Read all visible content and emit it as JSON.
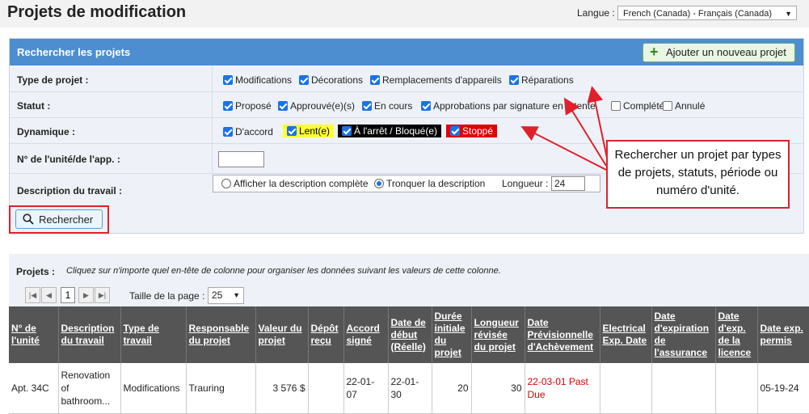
{
  "header": {
    "title": "Projets de modification",
    "language_label": "Langue :",
    "language_value": "French (Canada) - Français (Canada)"
  },
  "search": {
    "title": "Rechercher les projets",
    "add_button": "Ajouter un nouveau projet",
    "type_label": "Type de projet :",
    "type_options": [
      {
        "label": "Modifications",
        "checked": true
      },
      {
        "label": "Décorations",
        "checked": true
      },
      {
        "label": "Remplacements d'appareils",
        "checked": true
      },
      {
        "label": "Réparations",
        "checked": true
      }
    ],
    "status_label": "Statut :",
    "status_options": [
      {
        "label": "Proposé",
        "checked": true
      },
      {
        "label": "Approuvé(e)(s)",
        "checked": true
      },
      {
        "label": "En cours",
        "checked": true
      },
      {
        "label": "Approbations par signature en attente",
        "checked": true
      },
      {
        "label": "Complété",
        "checked": false
      },
      {
        "label": "Annulé",
        "checked": false
      }
    ],
    "dynamic_label": "Dynamique :",
    "dynamic_options": [
      {
        "label": "D'accord",
        "checked": true
      },
      {
        "label": "Lent(e)",
        "checked": true
      },
      {
        "label": "À l'arrêt / Bloqué(e)",
        "checked": true
      },
      {
        "label": "Stoppé",
        "checked": true
      }
    ],
    "unit_label": "N° de l'unité/de l'app. :",
    "unit_value": "",
    "work_label": "Description du travail :",
    "radio_full": "Afficher la description complète",
    "radio_truncate": "Tronquer la description",
    "length_label": "Longueur :",
    "length_value": "24",
    "search_button": "Rechercher"
  },
  "callout": {
    "text": "Rechercher un projet par types de projets, statuts, période ou numéro d'unité."
  },
  "projects": {
    "label": "Projets :",
    "hint": "Cliquez sur n'importe quel en-tête de colonne pour organiser les données suivant les valeurs de cette colonne.",
    "current_page": "1",
    "page_size_label": "Taille de la page :",
    "page_size": "25",
    "columns": [
      "N° de l'unité",
      "Description du travail",
      "Type de travail",
      "Responsable du projet",
      "Valeur du projet",
      "Dépôt reçu",
      "Accord signé",
      "Date de début (Réelle)",
      "Durée initiale du projet",
      "Longueur révisée du projet",
      "Date Prévisionnelle d'Achèvement",
      "Electrical Exp. Date",
      "Date d'expiration de l'assurance",
      "Date d'exp. de la licence",
      "Date exp. permis"
    ],
    "rows": [
      [
        "Apt. 34C",
        "Renovation of bathroom...",
        "Modifications",
        "Trauring",
        "3 576 $",
        "",
        "22-01-07",
        "22-01-30",
        "20",
        "30",
        "22-03-01 Past Due",
        "",
        "",
        "",
        "05-19-24"
      ]
    ]
  },
  "colors": {
    "header_blue": "#4c8ed0",
    "accent_red": "#e0202a",
    "table_header": "#555555",
    "overdue": "#dd0000"
  }
}
